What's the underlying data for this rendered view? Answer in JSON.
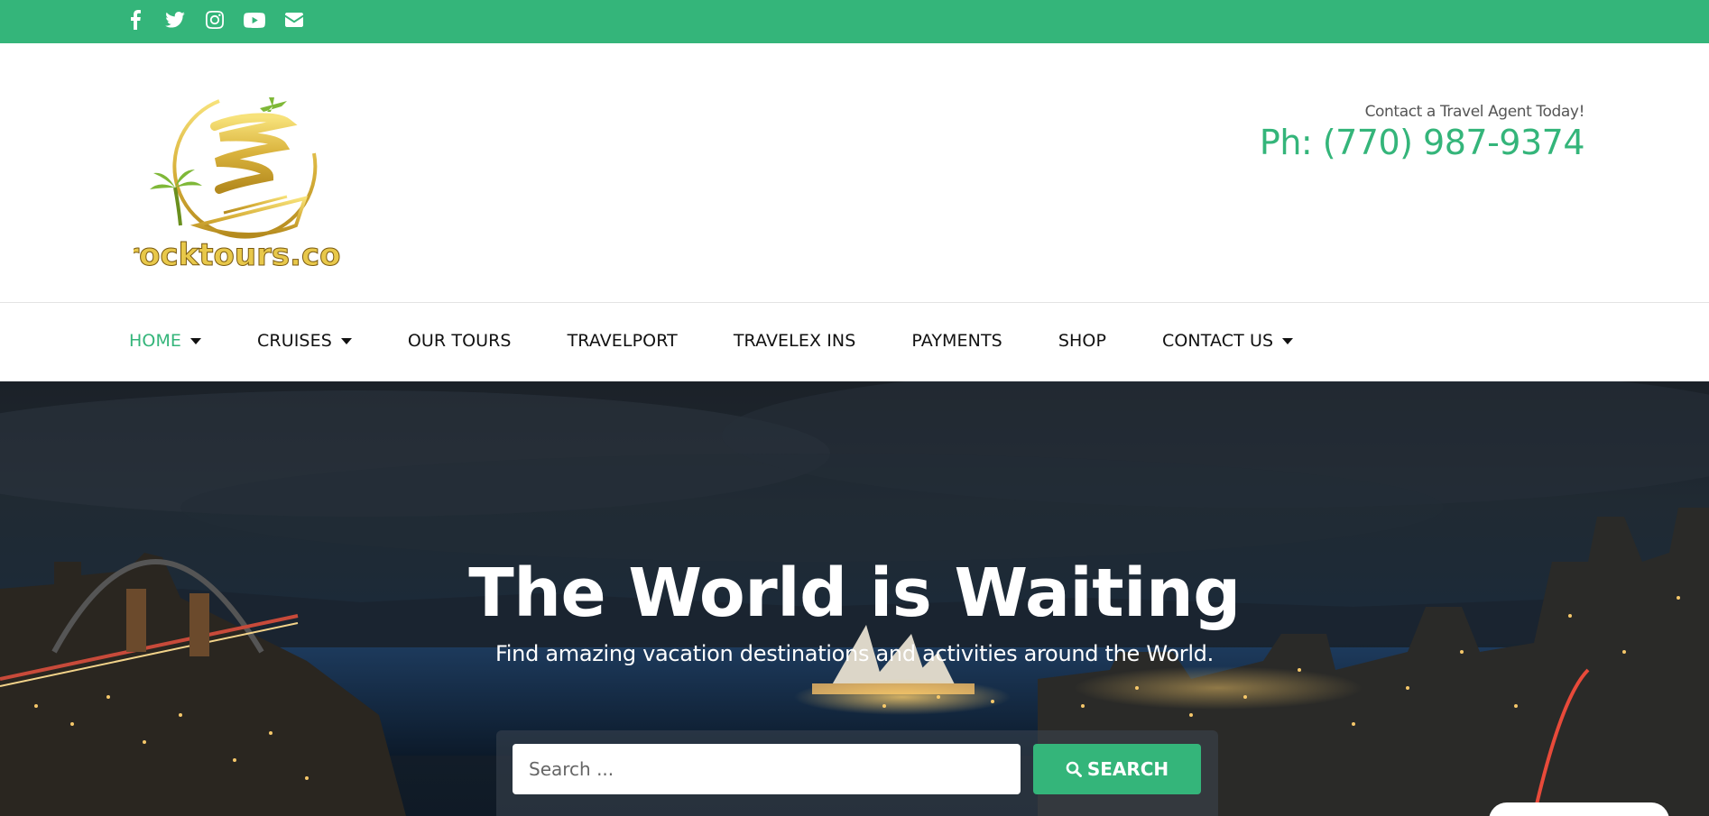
{
  "topbar": {
    "icons": [
      "facebook-icon",
      "twitter-icon",
      "instagram-icon",
      "youtube-icon",
      "envelope-icon"
    ],
    "color": "#34b57a"
  },
  "header": {
    "logo_text": "brocktours.com",
    "contact_tagline": "Contact a Travel Agent Today!",
    "phone": "Ph: (770) 987-9374"
  },
  "nav": {
    "items": [
      {
        "label": "HOME",
        "dropdown": true,
        "active": true
      },
      {
        "label": "CRUISES",
        "dropdown": true,
        "active": false
      },
      {
        "label": "OUR TOURS",
        "dropdown": false,
        "active": false
      },
      {
        "label": "TRAVELPORT",
        "dropdown": false,
        "active": false
      },
      {
        "label": "TRAVELEX INS",
        "dropdown": false,
        "active": false
      },
      {
        "label": "PAYMENTS",
        "dropdown": false,
        "active": false
      },
      {
        "label": "SHOP",
        "dropdown": false,
        "active": false
      },
      {
        "label": "CONTACT US",
        "dropdown": true,
        "active": false
      }
    ]
  },
  "hero": {
    "title": "The World is Waiting",
    "subtitle": "Find amazing vacation destinations and activities around the World.",
    "search": {
      "placeholder": "Search ...",
      "button_label": "SEARCH"
    }
  },
  "colors": {
    "accent": "#34b57a",
    "text": "#111111"
  }
}
